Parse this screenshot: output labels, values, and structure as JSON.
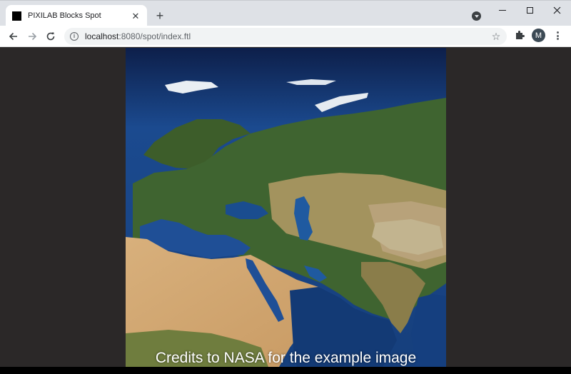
{
  "tab": {
    "title": "PIXILAB Blocks Spot"
  },
  "address": {
    "host": "localhost",
    "path": ":8080/spot/index.ftl"
  },
  "profile": {
    "initial": "M"
  },
  "content": {
    "caption": "Credits to NASA for the example image"
  },
  "colors": {
    "page_background": "#2b2828",
    "tab_strip": "#dee1e6",
    "avatar": "#3c4a55"
  }
}
